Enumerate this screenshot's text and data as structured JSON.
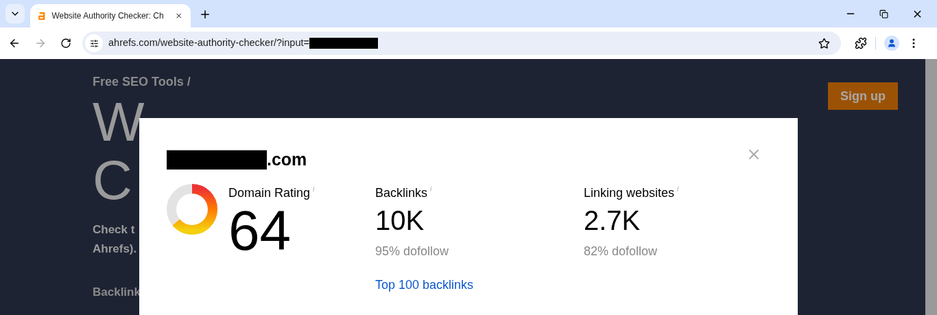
{
  "browser": {
    "tab": {
      "title": "Website Authority Checker: Ch",
      "selected": true
    },
    "url": "ahrefs.com/website-authority-checker/?input="
  },
  "page": {
    "breadcrumb": "Free SEO Tools /",
    "heading_line_1": "W",
    "heading_line_2": "C",
    "intro_line_1": "Check t",
    "intro_line_2": "Ahrefs).",
    "section_label": "Backlink",
    "signup": "Sign up"
  },
  "modal": {
    "domain_suffix": ".com",
    "domain_rating": {
      "label": "Domain Rating",
      "info": "i",
      "value": "64",
      "level": 0.64
    },
    "metrics": [
      {
        "label": "Backlinks",
        "info": "i",
        "value": "10K",
        "note": "95% dofollow",
        "link": "Top 100 backlinks"
      },
      {
        "label": "Linking websites",
        "info": "i",
        "value": "2.7K",
        "note": "82% dofollow"
      }
    ]
  }
}
